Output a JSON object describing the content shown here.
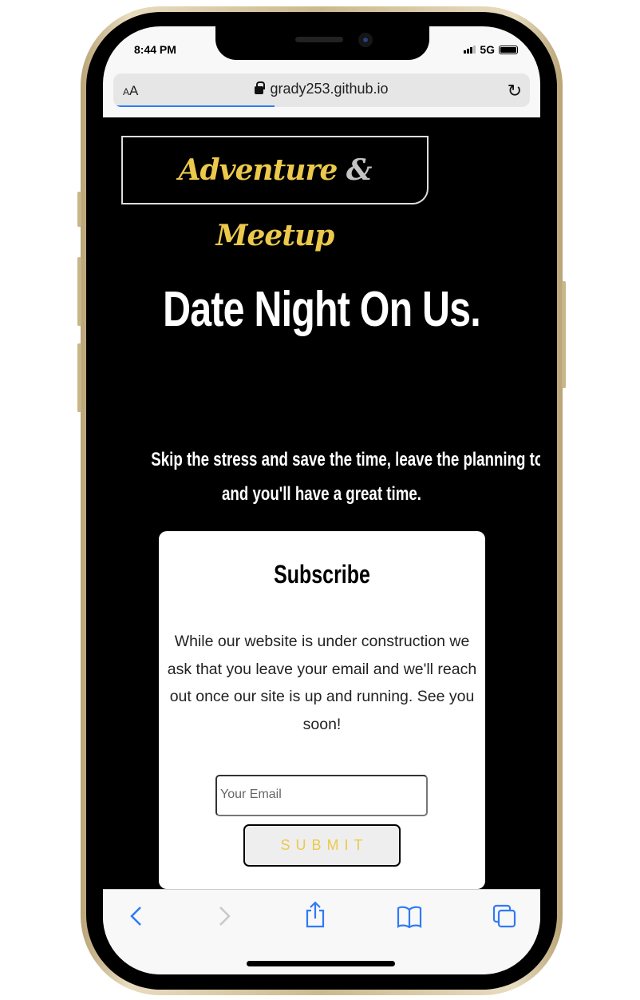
{
  "status_bar": {
    "time": "8:44 PM",
    "network": "5G"
  },
  "browser": {
    "text_size_label_small": "A",
    "text_size_label_large": "A",
    "url": "grady253.github.io",
    "load_progress": 0.38
  },
  "site": {
    "logo": {
      "word1": "Adventure",
      "amp": "&",
      "word2": "Meetup"
    },
    "headline": "Date Night On Us.",
    "tagline_line1": "Skip the stress and save the time, leave the planning to us",
    "tagline_line2": "and you'll have a great time.",
    "subscribe": {
      "title": "Subscribe",
      "body": "While our website is under construction we ask that you leave your email and we'll reach out once our site is up and running. See you soon!",
      "email_placeholder": "Your Email",
      "submit_label": "SUBMIT"
    }
  },
  "colors": {
    "accent": "#ecc94b",
    "link_blue": "#2f7af5"
  },
  "toolbar": {
    "icons": [
      "back-icon",
      "forward-icon",
      "share-icon",
      "bookmarks-icon",
      "tabs-icon"
    ]
  }
}
